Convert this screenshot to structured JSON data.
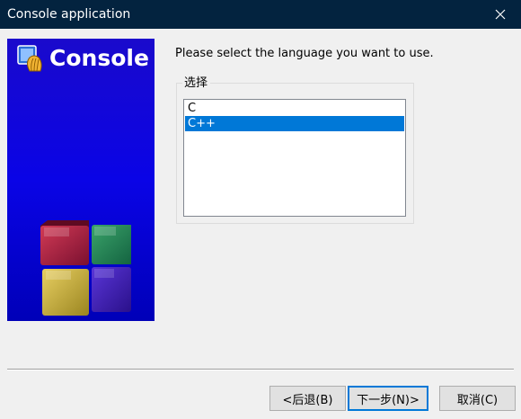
{
  "window": {
    "title": "Console application"
  },
  "banner": {
    "title": "Console",
    "logo_icon": "codeblocks-logo-icon",
    "cube_art": "cube-illustration",
    "background_color": "#0a04e6"
  },
  "main": {
    "prompt": "Please select the language you want to use.",
    "group_label": "选择",
    "language_list": {
      "items": [
        "C",
        "C++"
      ],
      "selected": "C++"
    }
  },
  "buttons": {
    "back_label": "<后退(B)",
    "next_label": "下一步(N)>",
    "cancel_label": "取消(C)"
  },
  "colors": {
    "titlebar": "#03233f",
    "selection": "#0078d7"
  }
}
